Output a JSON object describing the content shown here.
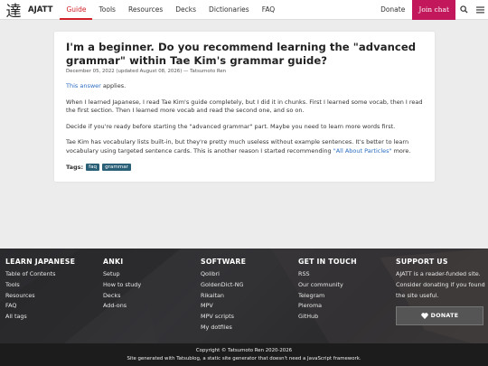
{
  "nav": {
    "logo_glyph": "達",
    "brand": "AJATT",
    "links": [
      "Guide",
      "Tools",
      "Resources",
      "Decks",
      "Dictionaries",
      "FAQ"
    ],
    "donate": "Donate",
    "join": "Join chat",
    "search_icon": "search-icon",
    "menu_icon": "menu-icon"
  },
  "article": {
    "title": "I'm a beginner. Do you recommend learning the \"advanced grammar\" within Tae Kim's grammar guide?",
    "meta": "December 05, 2022 (updated August 08, 2026) — Tatsumoto Ren",
    "p1_link": "This answer",
    "p1_rest": " applies.",
    "p2": "When I learned Japanese, I read Tae Kim's guide completely, but I did it in chunks. First I learned some vocab, then I read the first section. Then I learned more vocab and read the second one, and so on.",
    "p3": "Decide if you're ready before starting the \"advanced grammar\" part. Maybe you need to learn more words first.",
    "p4_text": "Tae Kim has vocabulary lists built-in, but they're pretty much useless without example sentences. It's better to learn vocabulary using targeted sentence cards. This is another reason I started recommending ",
    "p4_link": "\"All About Particles\"",
    "p4_end": " more.",
    "tags_label": "Tags:",
    "tags": [
      "faq",
      "grammar"
    ]
  },
  "footer": {
    "learn": {
      "heading": "LEARN JAPANESE",
      "items": [
        "Table of Contents",
        "Tools",
        "Resources",
        "FAQ",
        "All tags"
      ]
    },
    "anki": {
      "heading": "ANKI",
      "items": [
        "Setup",
        "How to study",
        "Decks",
        "Add-ons"
      ]
    },
    "software": {
      "heading": "SOFTWARE",
      "items": [
        "Qolibri",
        "GoldenDict-NG",
        "Rikaitan",
        "MPV",
        "MPV scripts",
        "My dotfiles"
      ]
    },
    "touch": {
      "heading": "GET IN TOUCH",
      "items": [
        "RSS",
        "Our community",
        "Telegram",
        "Pleroma",
        "GitHub"
      ]
    },
    "support": {
      "heading": "SUPPORT US",
      "text": "AJATT is a reader-funded site. Consider donating if you found the site useful.",
      "button": "DONATE",
      "heart_icon": "heart-icon"
    },
    "copyright": "Copyright © Tatsumoto Ren 2020-2026",
    "generator": "Site generated with Tatsublog, a static site generator that doesn't need a JavaScript framework."
  }
}
